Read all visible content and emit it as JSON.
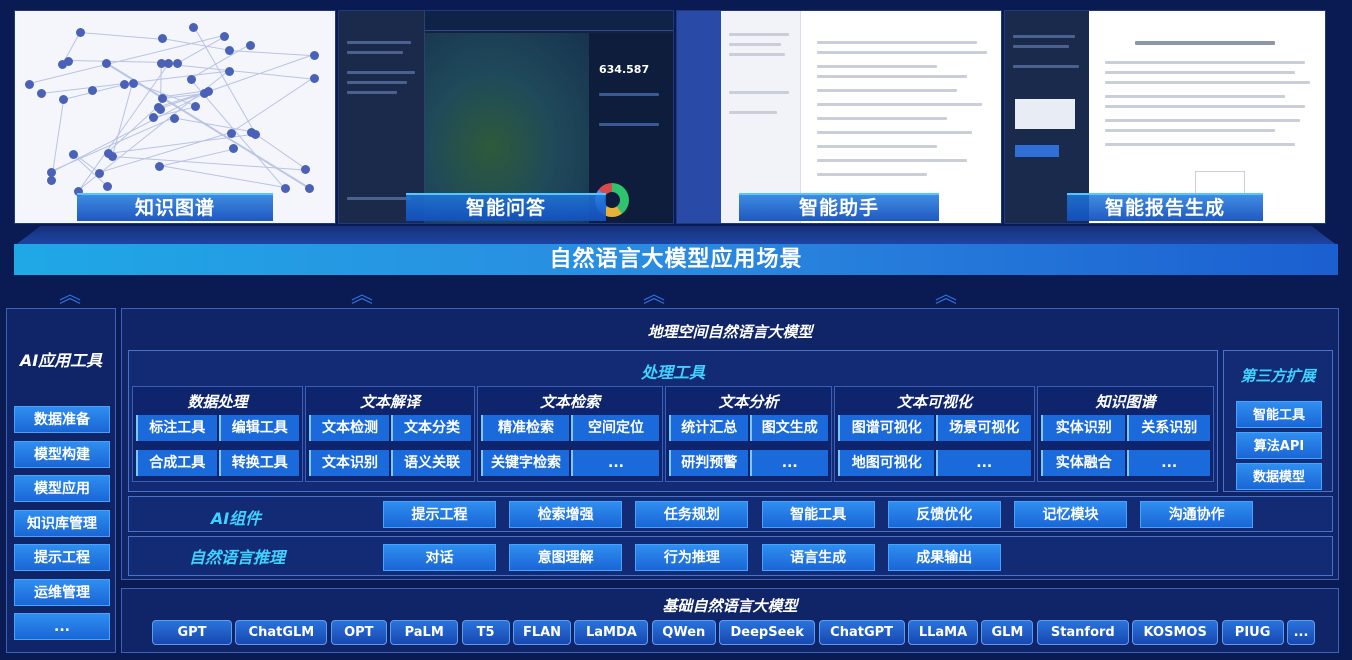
{
  "scenarios": {
    "banner": "自然语言大模型应用场景",
    "panels": [
      {
        "label": "知识图谱"
      },
      {
        "label": "智能问答",
        "stat": "634.587"
      },
      {
        "label": "智能助手"
      },
      {
        "label": "智能报告生成"
      }
    ]
  },
  "ai_tools": {
    "title": "AI应用工具",
    "items": [
      "数据准备",
      "模型构建",
      "模型应用",
      "知识库管理",
      "提示工程",
      "运维管理",
      "..."
    ]
  },
  "geo_model": {
    "title": "地理空间自然语言大模型",
    "processing": {
      "title": "处理工具",
      "groups": [
        {
          "title": "数据处理",
          "rows": [
            [
              "标注工具",
              "编辑工具"
            ],
            [
              "合成工具",
              "转换工具"
            ]
          ]
        },
        {
          "title": "文本解译",
          "rows": [
            [
              "文本检测",
              "文本分类"
            ],
            [
              "文本识别",
              "语义关联"
            ]
          ]
        },
        {
          "title": "文本检索",
          "rows": [
            [
              "精准检索",
              "空间定位"
            ],
            [
              "关键字检索",
              "..."
            ]
          ]
        },
        {
          "title": "文本分析",
          "rows": [
            [
              "统计汇总",
              "图文生成"
            ],
            [
              "研判预警",
              "..."
            ]
          ]
        },
        {
          "title": "文本可视化",
          "rows": [
            [
              "图谱可视化",
              "场景可视化"
            ],
            [
              "地图可视化",
              "..."
            ]
          ]
        },
        {
          "title": "知识图谱",
          "rows": [
            [
              "实体识别",
              "关系识别"
            ],
            [
              "实体融合",
              "..."
            ]
          ]
        }
      ]
    },
    "third_party": {
      "title": "第三方扩展",
      "items": [
        "智能工具",
        "算法API",
        "数据模型"
      ]
    },
    "ai_components": {
      "title": "AI组件",
      "items": [
        "提示工程",
        "检索增强",
        "任务规划",
        "智能工具",
        "反馈优化",
        "记忆模块",
        "沟通协作"
      ]
    },
    "nl_reasoning": {
      "title": "自然语言推理",
      "items": [
        "对话",
        "意图理解",
        "行为推理",
        "语言生成",
        "成果输出"
      ]
    }
  },
  "base_model": {
    "title": "基础自然语言大模型",
    "items": [
      "GPT",
      "ChatGLM",
      "OPT",
      "PaLM",
      "T5",
      "FLAN",
      "LaMDA",
      "QWen",
      "DeepSeek",
      "ChatGPT",
      "LLaMA",
      "GLM",
      "Stanford",
      "KOSMOS",
      "PIUG",
      "..."
    ]
  }
}
